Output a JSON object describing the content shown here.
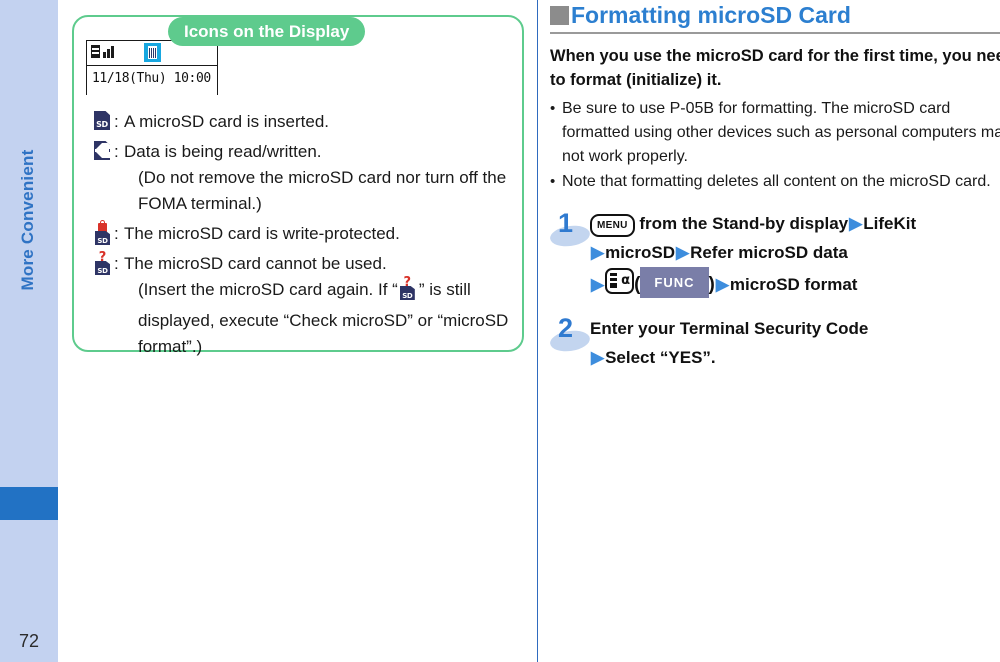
{
  "sidebar": {
    "chapter_label": "More Convenient",
    "page_number": "72",
    "colors": {
      "background": "#c3d2f0",
      "tab": "#2272c4",
      "text": "#2f73c4"
    }
  },
  "left_panel": {
    "tab_title": "Icons on the Display",
    "border_color": "#5ecb8d",
    "phone_mock": {
      "battery_icon": "battery-icon",
      "signal_icon": "signal-bars-icon",
      "highlighted_icon": "microsd-inserted-icon",
      "datetime": "11/18(Thu) 10:00"
    },
    "icons": [
      {
        "icon": "microsd-card-icon",
        "label": "SD",
        "colon": ":",
        "text": "A microSD card is inserted.",
        "sub": ""
      },
      {
        "icon": "microsd-read-write-icon",
        "label": "",
        "colon": ":",
        "text": "Data is being read/written.",
        "sub": "(Do not remove the microSD card nor turn off the FOMA terminal.)"
      },
      {
        "icon": "microsd-write-protected-icon",
        "label": "SD",
        "colon": ":",
        "text": "The microSD card is write-protected.",
        "sub": ""
      },
      {
        "icon": "microsd-unusable-icon",
        "label": "SD",
        "colon": ":",
        "text": "The microSD card cannot be used.",
        "sub_pre": "(Insert the microSD card again. If “",
        "sub_post": "” is still displayed, execute “Check microSD” or “microSD format”.)"
      }
    ]
  },
  "right_column": {
    "section_title": "Formatting microSD Card",
    "section_title_color": "#2c7fd0",
    "marker_icon": "square-bullet-icon",
    "lead": "When you use the microSD card for the first time, you need to format (initialize) it.",
    "bullets": [
      {
        "dot": "•",
        "text": "Be sure to use P-05B for formatting. The microSD card formatted using other devices such as personal computers may not work properly."
      },
      {
        "dot": "•",
        "text": "Note that formatting deletes all content on the microSD card."
      }
    ],
    "steps": [
      {
        "number": "1",
        "line1_key": "MENU",
        "line1_a": " from the Stand-by display",
        "line1_b": "LifeKit",
        "line2_a": "microSD",
        "line2_b": "Refer microSD data",
        "line3_badge": "FUNC",
        "line3_paren_open": "(",
        "line3_paren_close": ")",
        "line3_b": "microSD format",
        "func_key_icon": "function-key-icon"
      },
      {
        "number": "2",
        "line1": "Enter your Terminal Security Code",
        "line2": "Select “YES”."
      }
    ],
    "arrow_glyph": "▶",
    "arrow_color": "#3d8ddd"
  }
}
